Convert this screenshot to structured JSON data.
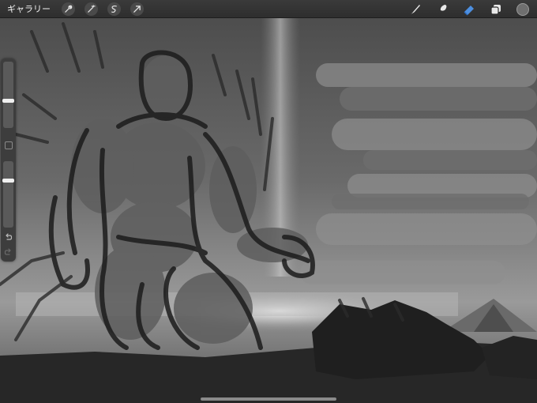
{
  "topbar": {
    "gallery_label": "ギャラリー",
    "left_tools": [
      "wrench-icon",
      "magic-wand-icon",
      "selection-icon",
      "transform-arrow-icon"
    ],
    "right_tools": [
      "brush-icon",
      "smudge-icon",
      "eraser-icon",
      "layers-icon",
      "color-icon"
    ],
    "active_tool": "eraser",
    "current_color": "#6f6f6f"
  },
  "sidebar": {
    "brush_size_level": 0.6,
    "opacity_level": 0.7,
    "undo_icon": "undo-icon",
    "redo_icon": "redo-icon"
  },
  "colors": {
    "active_tool": "#4d8fe0",
    "toolbar": "#2e2e2e",
    "sidebar": "#3d3d3d"
  }
}
